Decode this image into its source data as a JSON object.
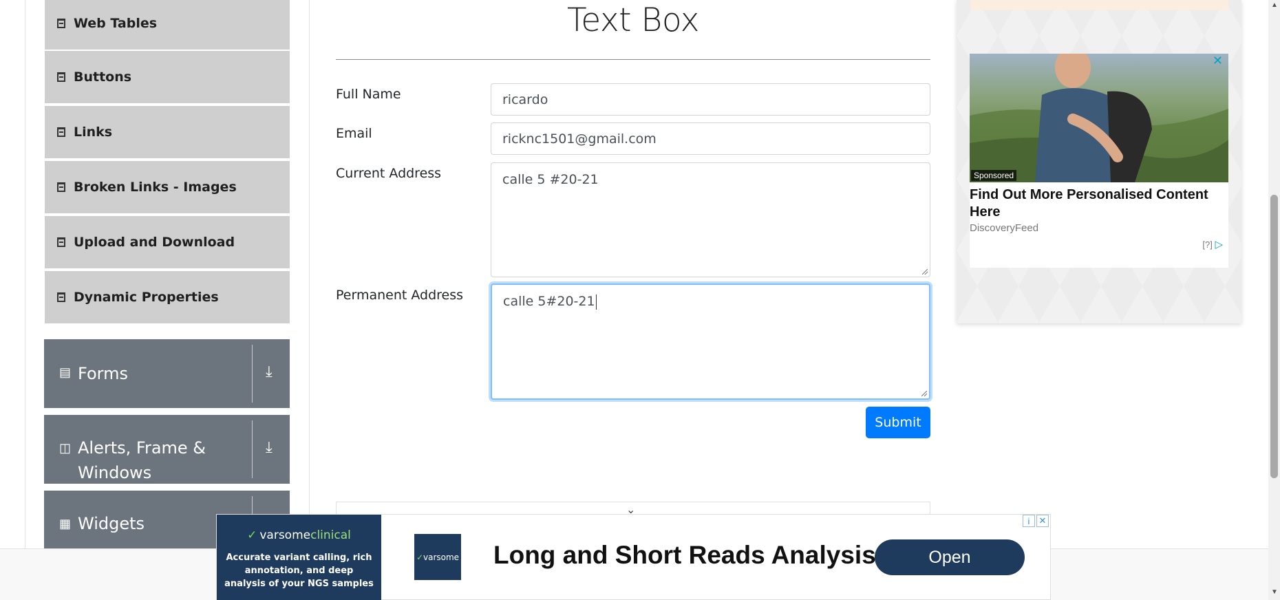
{
  "sidebar": {
    "items": [
      {
        "label": "Web Tables",
        "icon": "html5-icon"
      },
      {
        "label": "Buttons",
        "icon": "html5-icon"
      },
      {
        "label": "Links",
        "icon": "html5-icon"
      },
      {
        "label": "Broken Links - Images",
        "icon": "html5-icon"
      },
      {
        "label": "Upload and Download",
        "icon": "html5-icon"
      },
      {
        "label": "Dynamic Properties",
        "icon": "html5-icon"
      }
    ],
    "groups": [
      {
        "label": "Forms",
        "icon": "document-icon"
      },
      {
        "label": "Alerts, Frame & Windows",
        "icon": "window-icon"
      },
      {
        "label": "Widgets",
        "icon": "widgets-icon"
      }
    ]
  },
  "main": {
    "title": "Text Box",
    "form": {
      "full_name_label": "Full Name",
      "full_name_value": "ricardo",
      "email_label": "Email",
      "email_value": "ricknc1501@gmail.com",
      "current_address_label": "Current Address",
      "current_address_value": "calle 5 #20-21",
      "permanent_address_label": "Permanent Address",
      "permanent_address_value": "calle 5#20-21",
      "submit_label": "Submit"
    }
  },
  "ad_right": {
    "sponsored_label": "Sponsored",
    "headline": "Find Out More Personalised Content Here",
    "source": "DiscoveryFeed",
    "info_label": "[?]"
  },
  "banner": {
    "brand_part1": "varsome",
    "brand_part2": "clinical",
    "tagline": "Accurate variant calling, rich annotation, and deep analysis of your NGS samples",
    "logo_text": "varsome",
    "headline": "Long and Short Reads Analysis",
    "open_label": "Open"
  },
  "colors": {
    "sidebar_item_bg": "#cfcfcf",
    "group_bg": "#6c757d",
    "submit_bg": "#007bff",
    "banner_navy": "#1e3a5c",
    "focus_border": "#80bdff"
  }
}
